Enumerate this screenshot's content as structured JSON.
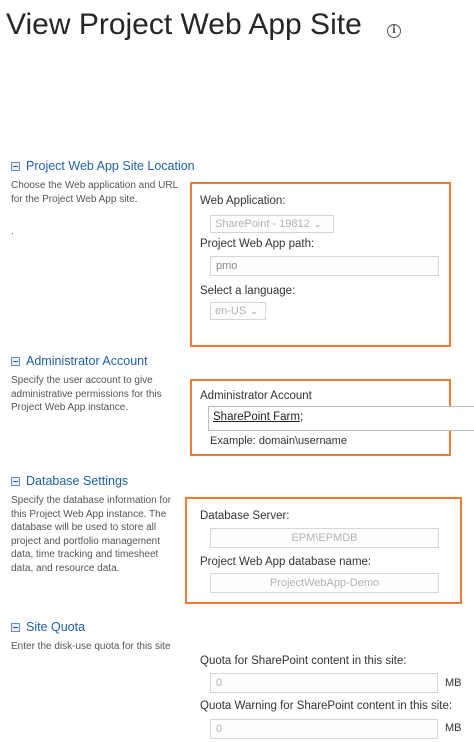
{
  "header": {
    "title": "View Project Web App Site"
  },
  "sections": {
    "location": {
      "title": "Project Web App Site Location",
      "description": "Choose the Web application and URL for the Project Web App site.",
      "extra": ".",
      "web_application_label": "Web Application:",
      "web_application_value": "SharePoint - 19812",
      "path_label": "Project Web App path:",
      "path_value": "pmo",
      "language_label": "Select a language:",
      "language_value": "en-US"
    },
    "admin": {
      "title": "Administrator Account",
      "description": "Specify the user account to give administrative permissions for this Project Web App instance.",
      "field_label": "Administrator Account",
      "field_value": "SharePoint Farm",
      "field_suffix": ";",
      "example": "Example: domain\\username"
    },
    "database": {
      "title": "Database Settings",
      "description": "Specify the database information for this Project Web App instance. The database will be used to store all project and portfolio management data, time tracking and timesheet data, and resource data.",
      "server_label": "Database Server:",
      "server_value": "EPM\\EPMDB",
      "dbname_label": "Project Web App database name:",
      "dbname_value": "ProjectWebApp-Demo"
    },
    "quota": {
      "title": "Site Quota",
      "description": "Enter the disk-use quota for this site",
      "quota_label": "Quota for SharePoint content in this site:",
      "quota_value": "0",
      "quota_unit": "MB",
      "warning_label": "Quota Warning for SharePoint content in this site:",
      "warning_value": "0",
      "warning_unit": "MB"
    }
  },
  "colors": {
    "highlight_border": "#ee7d2f",
    "section_title": "#1f5fa8"
  }
}
